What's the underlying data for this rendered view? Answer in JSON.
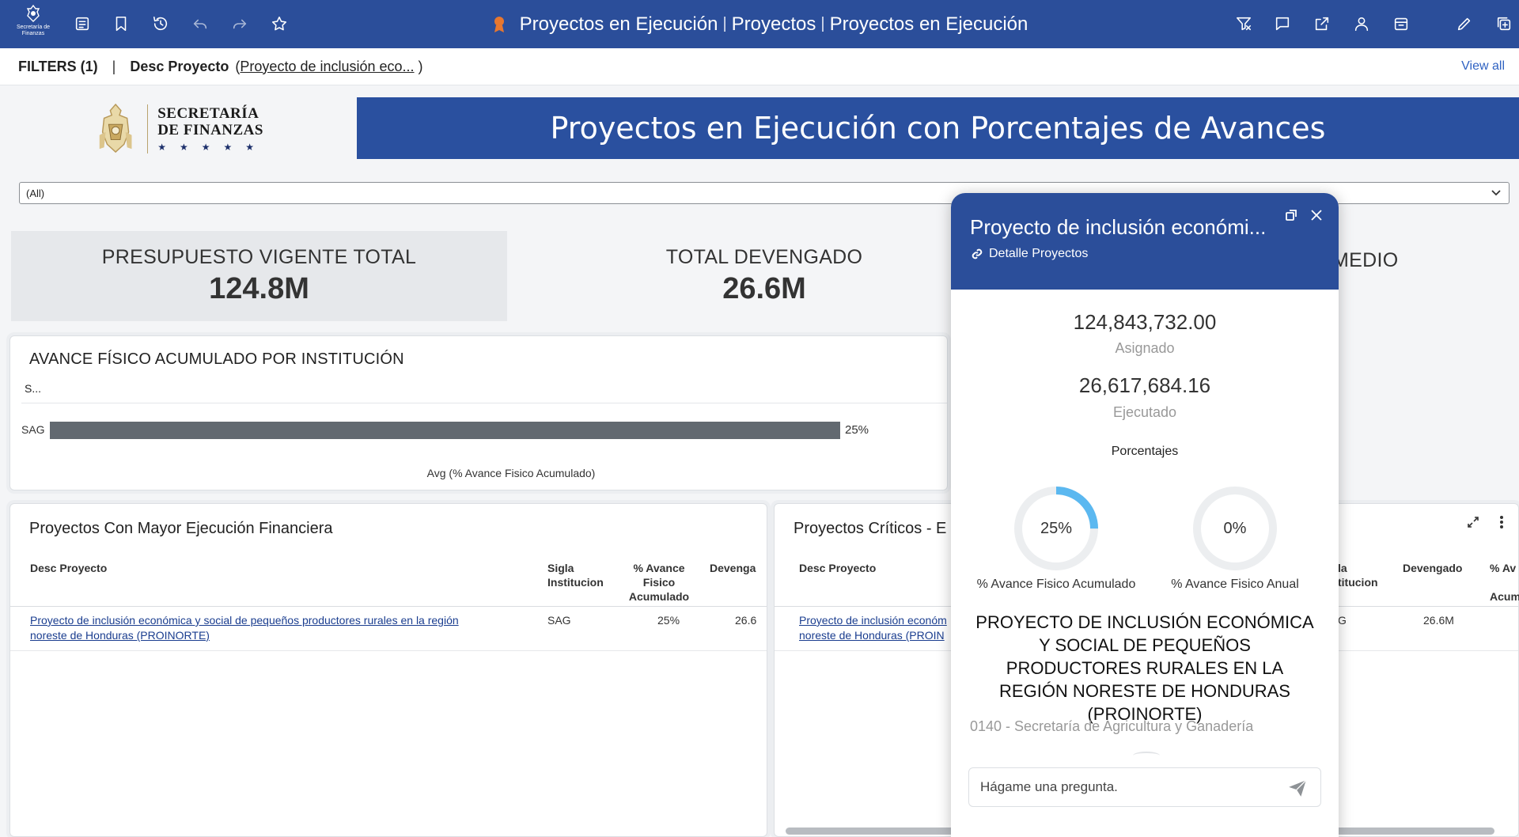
{
  "toolbar": {
    "logo_text": "Secretaría de Finanzas",
    "title_parts": [
      "Proyectos en Ejecución",
      "Proyectos",
      "Proyectos en Ejecución"
    ]
  },
  "filters": {
    "label": "FILTERS (1)",
    "field": "Desc Proyecto",
    "value": "Proyecto de inclusión eco...",
    "view_all": "View all"
  },
  "brand": {
    "line1": "SECRETARÍA",
    "line2": "DE FINANZAS",
    "stars": "★★★★★"
  },
  "banner": {
    "title": "Proyectos en Ejecución con Porcentajes de Avances"
  },
  "select": {
    "value": "(All)"
  },
  "kpis": [
    {
      "label": "PRESUPUESTO VIGENTE TOTAL",
      "value": "124.8M"
    },
    {
      "label": "TOTAL DEVENGADO",
      "value": "26.6M"
    },
    {
      "label": "MEDIO"
    }
  ],
  "avance_panel": {
    "title": "AVANCE FÍSICO ACUMULADO POR INSTITUCIÓN",
    "axis_header": "S...",
    "x_label": "Avg (% Avance Fisico Acumulado)"
  },
  "chart_data": {
    "type": "bar",
    "orientation": "horizontal",
    "categories": [
      "SAG"
    ],
    "values": [
      25
    ],
    "value_labels": [
      "25%"
    ],
    "xlabel": "Avg (% Avance Fisico Acumulado)",
    "ylabel": "S..."
  },
  "mayor_panel": {
    "title": "Proyectos Con Mayor Ejecución Financiera",
    "headers": {
      "desc": "Desc Proyecto",
      "sigla_1": "Sigla",
      "sigla_2": "Institucion",
      "av_1": "% Avance",
      "av_2": "Fisico",
      "av_3": "Acumulado",
      "dev": "Devenga"
    },
    "row": {
      "desc_1": "Proyecto de inclusión económica y social de pequeños productores rurales en la región",
      "desc_2": "noreste de Honduras (PROINORTE)",
      "sigla": "SAG",
      "avance": "25%",
      "devengado": "26.6"
    }
  },
  "criticos_panel": {
    "title": "Proyectos Críticos - E",
    "headers": {
      "desc": "Desc Proyecto",
      "sigla_1": "la",
      "sigla_2": "titucion",
      "dev": "Devengado",
      "av_1": "% Av",
      "av_2": "Acum"
    },
    "row": {
      "desc_1": "Proyecto de inclusión económ",
      "desc_2": "noreste de Honduras (PROIN",
      "sigla": "G",
      "devengado": "26.6M"
    }
  },
  "popup": {
    "title": "Proyecto de inclusión económi...",
    "subtitle": "Detalle Proyectos",
    "asignado_value": "124,843,732.00",
    "asignado_label": "Asignado",
    "ejecutado_value": "26,617,684.16",
    "ejecutado_label": "Ejecutado",
    "porcentajes_label": "Porcentajes",
    "donuts": [
      {
        "value": 25,
        "label": "25%",
        "caption": "% Avance Fisico Acumulado"
      },
      {
        "value": 0,
        "label": "0%",
        "caption": "% Avance Fisico Anual"
      }
    ],
    "description": "PROYECTO DE INCLUSIÓN ECONÓMICA Y SOCIAL DE PEQUEÑOS PRODUCTORES RURALES EN LA REGIÓN NORESTE DE HONDURAS (PROINORTE)",
    "institution": "0140 - Secretaría de Agricultura y Ganadería",
    "ask_placeholder": "Hágame una pregunta."
  },
  "colors": {
    "header_blue": "#2b4e9a",
    "bar_gray": "#626970",
    "donut_accent": "#5bb8f0",
    "donut_track": "#eceef0",
    "link_blue": "#1a3d8f"
  }
}
